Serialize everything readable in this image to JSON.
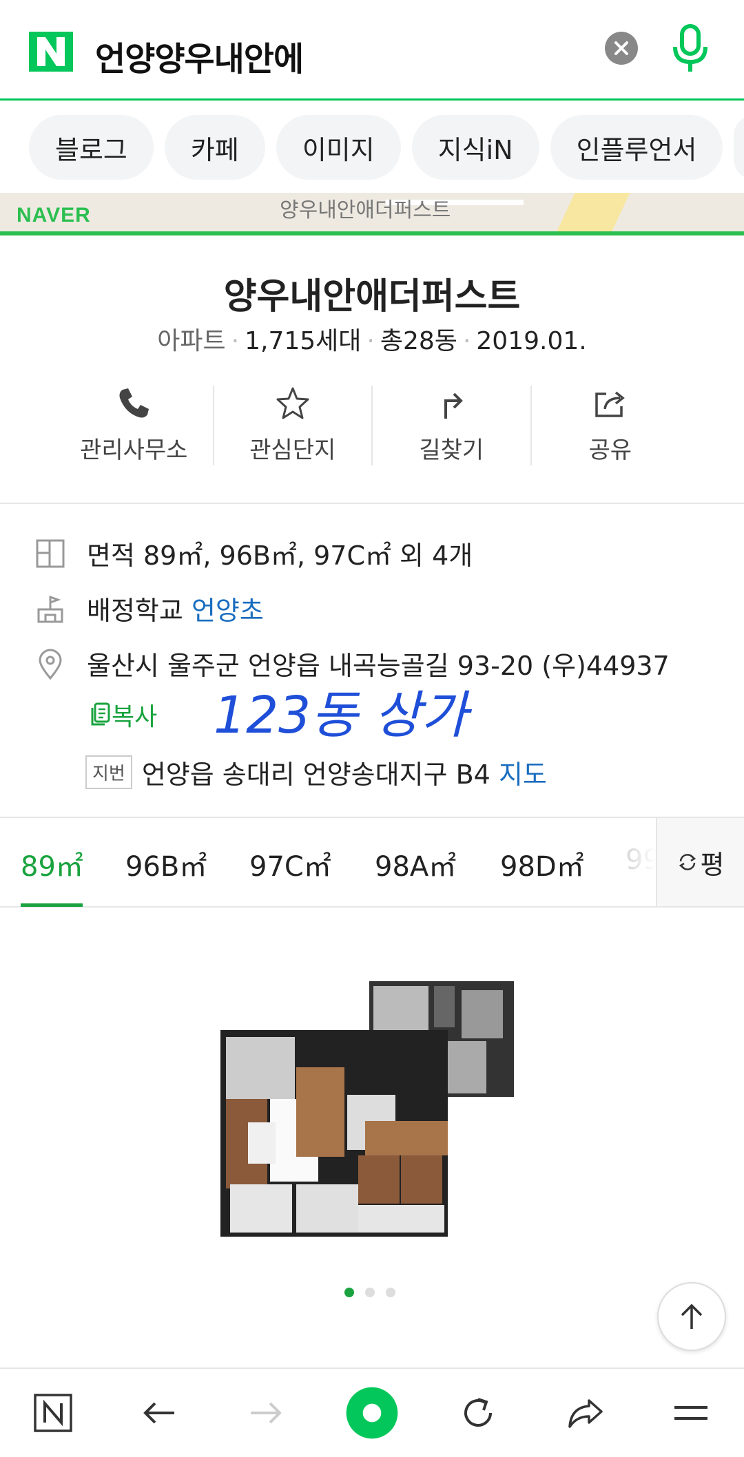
{
  "search": {
    "query": "언양양우내안에"
  },
  "tabs": [
    "블로그",
    "카페",
    "이미지",
    "지식iN",
    "인플루언서"
  ],
  "map": {
    "label": "양우내안애더퍼스트",
    "brand": "NAVER"
  },
  "complex": {
    "name": "양우내안애더퍼스트",
    "type": "아파트",
    "households": "1,715세대",
    "buildings": "총28동",
    "date": "2019.01."
  },
  "actions": [
    {
      "label": "관리사무소",
      "icon": "phone-icon"
    },
    {
      "label": "관심단지",
      "icon": "star-icon"
    },
    {
      "label": "길찾기",
      "icon": "directions-icon"
    },
    {
      "label": "공유",
      "icon": "share-icon"
    }
  ],
  "info": {
    "area": "면적 89㎡, 96B㎡, 97C㎡ 외 4개",
    "school_label": "배정학교",
    "school_link": "언양초",
    "address": "울산시 울주군 언양읍 내곡능골길 93-20 (우)44937",
    "copy_label": "복사",
    "handwritten_note": "123동 상가",
    "jibun_badge": "지번",
    "jibun_address": "언양읍 송대리 언양송대지구 B4",
    "map_link": "지도"
  },
  "area_tabs": [
    "89㎡",
    "96B㎡",
    "97C㎡",
    "98A㎡",
    "98D㎡",
    "99"
  ],
  "area_active_index": 0,
  "unit_toggle_label": "평",
  "pager": {
    "count": 3,
    "active": 0
  },
  "colors": {
    "naver_green": "#03c75a",
    "link_blue": "#1a6dbf",
    "accent_green": "#1aa33f"
  }
}
